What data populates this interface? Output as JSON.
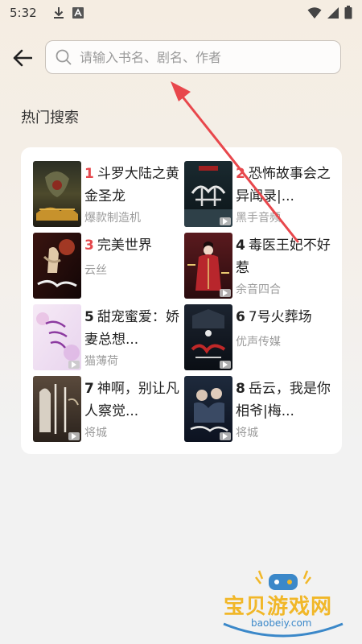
{
  "status_bar": {
    "time": "5:32"
  },
  "search": {
    "placeholder": "请输入书名、剧名、作者",
    "value": ""
  },
  "section": {
    "title": "热门搜索"
  },
  "books": [
    {
      "rank": "1",
      "title": "斗罗大陆之黄金圣龙",
      "author": "爆款制造机"
    },
    {
      "rank": "2",
      "title": "恐怖故事会之异闻录|...",
      "author": "黑手音频"
    },
    {
      "rank": "3",
      "title": "完美世界",
      "author": "云丝"
    },
    {
      "rank": "4",
      "title": "毒医王妃不好惹",
      "author": "余音四合"
    },
    {
      "rank": "5",
      "title": "甜宠蜜爱：娇妻总想...",
      "author": "猫薄荷"
    },
    {
      "rank": "6",
      "title": "7号火葬场",
      "author": "优声传媒"
    },
    {
      "rank": "7",
      "title": "神啊，别让凡人察觉...",
      "author": "将城"
    },
    {
      "rank": "8",
      "title": "岳云，我是你相爷|梅...",
      "author": "将城"
    }
  ],
  "watermark": {
    "title": "宝贝游戏网",
    "url": "baobeiy.com"
  },
  "colors": {
    "rank_hot": "#e5484d",
    "annotation_arrow": "#e8474c"
  }
}
